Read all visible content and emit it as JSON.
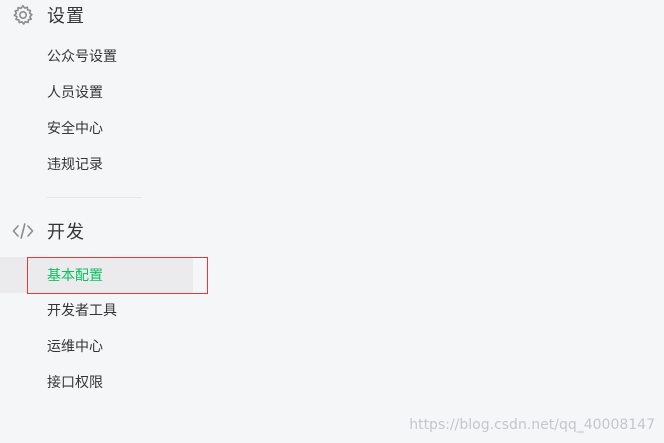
{
  "settings": {
    "title": "设置",
    "icon": "gear-icon",
    "items": [
      {
        "label": "公众号设置"
      },
      {
        "label": "人员设置"
      },
      {
        "label": "安全中心"
      },
      {
        "label": "违规记录"
      }
    ]
  },
  "development": {
    "title": "开发",
    "icon": "code-icon",
    "items": [
      {
        "label": "基本配置",
        "active": true
      },
      {
        "label": "开发者工具"
      },
      {
        "label": "运维中心"
      },
      {
        "label": "接口权限"
      }
    ]
  },
  "watermark": "https://blog.csdn.net/qq_40008147",
  "colors": {
    "background": "#f5f6f8",
    "active_text": "#07c160",
    "active_bg": "#ebebed",
    "highlight_border": "#e03b3b",
    "text": "#353535",
    "icon": "#8c8c8c"
  }
}
